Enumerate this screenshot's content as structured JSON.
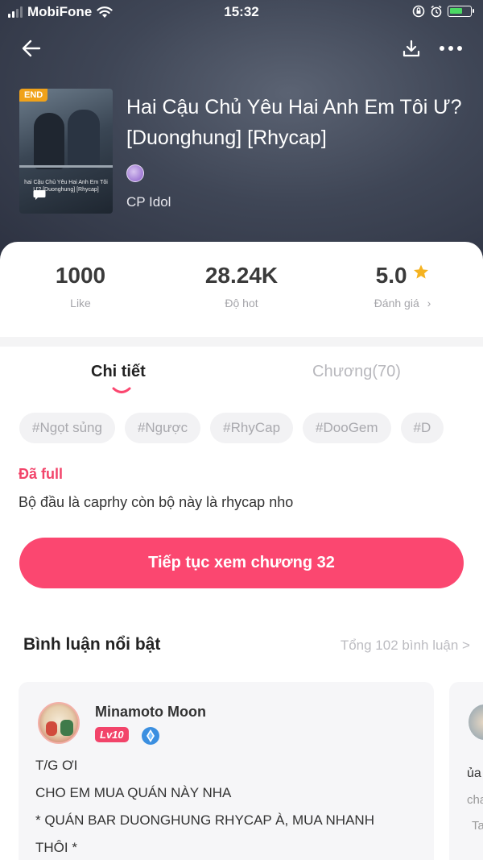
{
  "status_bar": {
    "carrier": "MobiFone",
    "time": "15:32"
  },
  "story": {
    "badge": "END",
    "title": "Hai Cậu Chủ Yêu Hai Anh Em Tôi Ư? [Duonghung] [Rhycap]",
    "cover_text": "hai Cậu Chủ Yêu Hai Anh Em Tôi Ư? [Duonghung] [Rhycap]",
    "category": "CP Idol"
  },
  "stats": {
    "like": {
      "value": "1000",
      "label": "Like"
    },
    "hot": {
      "value": "28.24K",
      "label": "Độ hot"
    },
    "rating": {
      "value": "5.0",
      "label": "Đánh giá",
      "chevron": "›"
    }
  },
  "tabs": {
    "detail": "Chi tiết",
    "chapters": "Chương(70)"
  },
  "tags": [
    "#Ngọt sủng",
    "#Ngược",
    "#RhyCap",
    "#DooGem",
    "#D"
  ],
  "status_label": "Đã full",
  "description": "Bộ đầu là caprhy còn bộ này là rhycap nho",
  "cta": "Tiếp tục xem chương 32",
  "comments_section": {
    "title": "Bình luận nổi bật",
    "total": "Tổng 102 bình luận >"
  },
  "featured_comment": {
    "user": "Minamoto Moon",
    "level": "Lv10",
    "text": [
      "T/G ƠI",
      "CHO EM MUA QUÁN NÀY NHA",
      "* QUÁN BAR DUONGHUNG RHYCAP À, MUA NHANH",
      "THÔI *"
    ]
  },
  "peek_comment": {
    "line1": "ủa",
    "line2": "cha",
    "line3": "Ta"
  },
  "colors": {
    "accent": "#fb4770",
    "header_bg": "#3f4656",
    "rating_star": "#f5b321",
    "end_badge": "#f0a21a"
  }
}
